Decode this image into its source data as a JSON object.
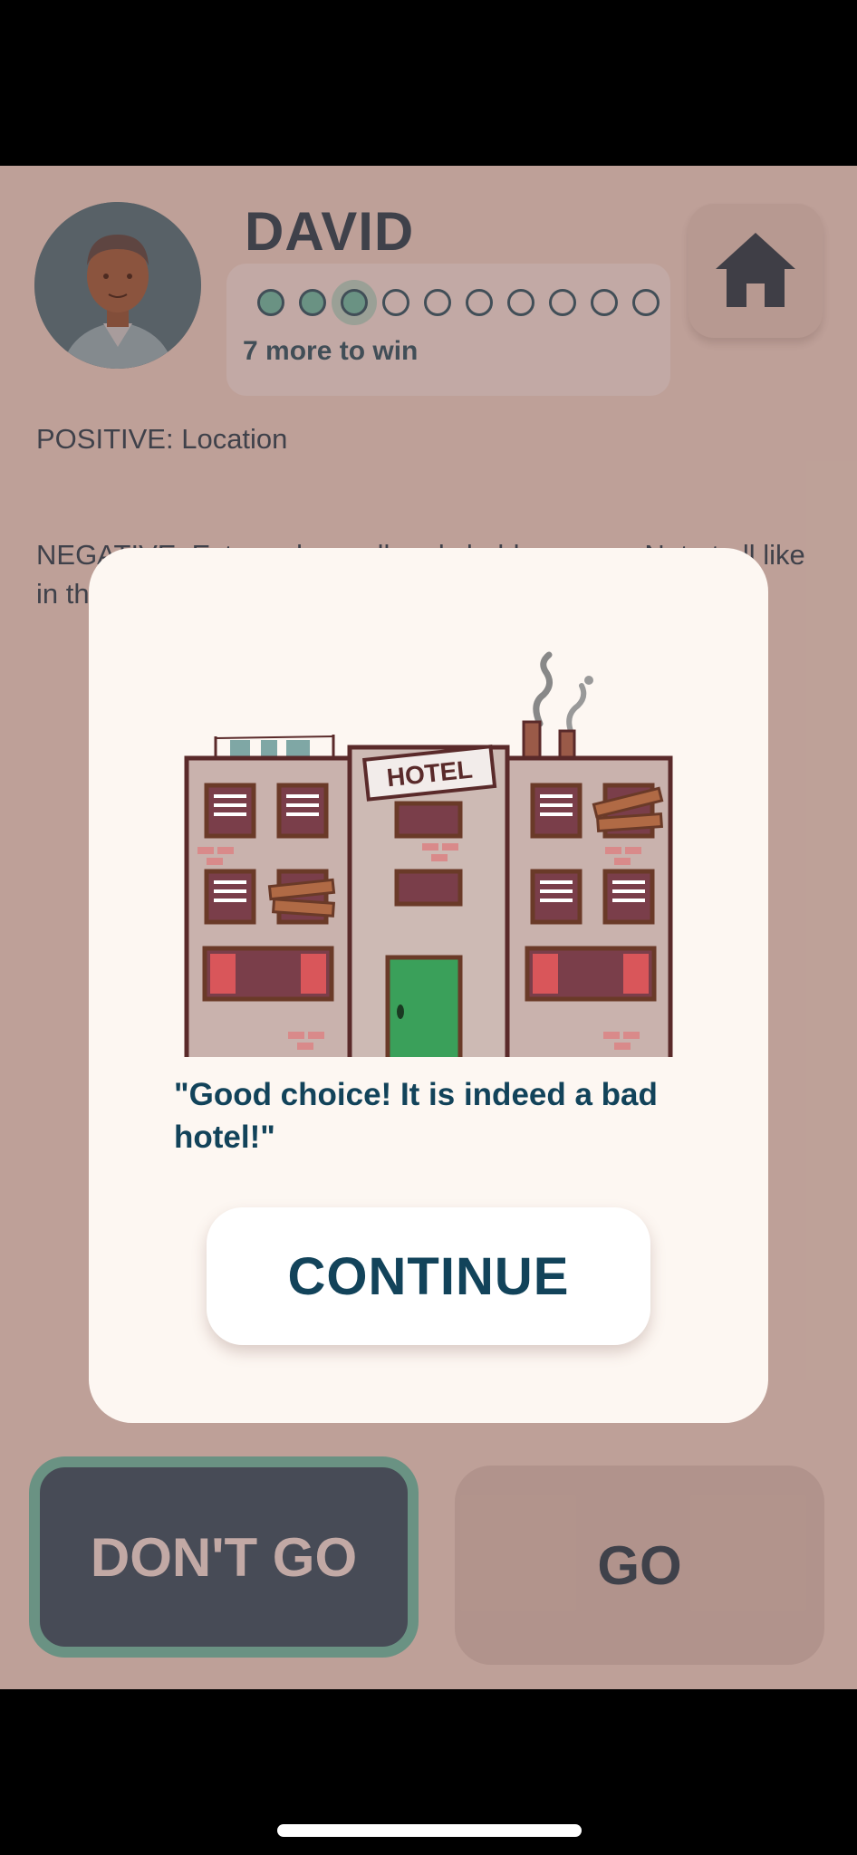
{
  "player": {
    "name": "DAVID",
    "progress_text": "7 more to win",
    "progress": {
      "completed": 3,
      "total": 10
    }
  },
  "review": {
    "positive": "POSITIVE: Location",
    "negative": "NEGATIVE: Extremely small and shabby rooms. Not at all like in the photos. The lift was broken and the bathroom ope"
  },
  "actions": {
    "dont_go_label": "DON'T GO",
    "go_label": "GO"
  },
  "modal": {
    "message": "\"Good choice! It is indeed a bad hotel!\"",
    "continue_label": "CONTINUE",
    "sign_text": "HOTEL"
  },
  "icons": {
    "home": "home-icon",
    "avatar": "avatar-man"
  },
  "colors": {
    "primary": "#12435a",
    "accent": "#5fd6c2",
    "dont_go_bg": "#1f5570",
    "modal_bg": "#fdf7f2"
  }
}
